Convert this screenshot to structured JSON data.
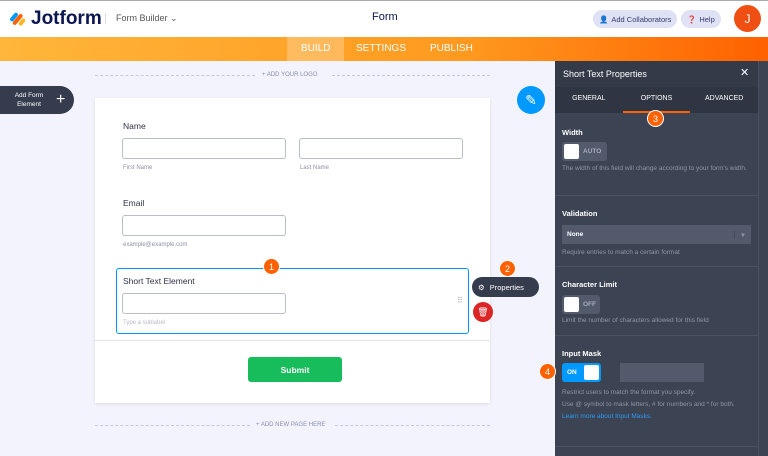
{
  "header": {
    "brand": "Jotform",
    "builder": "Form Builder",
    "title": "Form",
    "add_collaborators": "Add Collaborators",
    "help": "Help",
    "avatar": "J"
  },
  "tabs": [
    {
      "label": "BUILD",
      "active": true
    },
    {
      "label": "SETTINGS"
    },
    {
      "label": "PUBLISH"
    }
  ],
  "canvas": {
    "add_logo": "+ ADD YOUR LOGO",
    "add_page": "+ ADD NEW PAGE HERE",
    "add_element": "Add Form Element"
  },
  "form": {
    "name_label": "Name",
    "first": "First Name",
    "last": "Last Name",
    "email_label": "Email",
    "email_sub": "example@example.com",
    "short_label": "Short Text Element",
    "short_sub": "Type a sublabel",
    "submit": "Submit"
  },
  "properties_button": "Properties",
  "badges": [
    "1",
    "2",
    "3",
    "4"
  ],
  "panel": {
    "title": "Short Text Properties",
    "close": "✕",
    "tabs": [
      "GENERAL",
      "OPTIONS",
      "ADVANCED"
    ],
    "active_tab": "OPTIONS",
    "width": {
      "label": "Width",
      "toggle": "AUTO",
      "desc": "The width of this field will change according to your form's width."
    },
    "validation": {
      "label": "Validation",
      "value": "None",
      "desc": "Require entries to match a certain format"
    },
    "char_limit": {
      "label": "Character Limit",
      "toggle": "OFF",
      "desc": "Limit the number of characters allowed for this field"
    },
    "input_mask": {
      "label": "Input Mask",
      "toggle": "ON",
      "desc1": "Restrict users to match the format you specify.",
      "desc2": "Use @ symbol to mask letters, # for numbers and * for both.",
      "link": "Learn more about Input Masks."
    }
  },
  "colors": {
    "orange": "#ff6100",
    "accent": "#0099ff",
    "submit": "#18bd5b"
  }
}
